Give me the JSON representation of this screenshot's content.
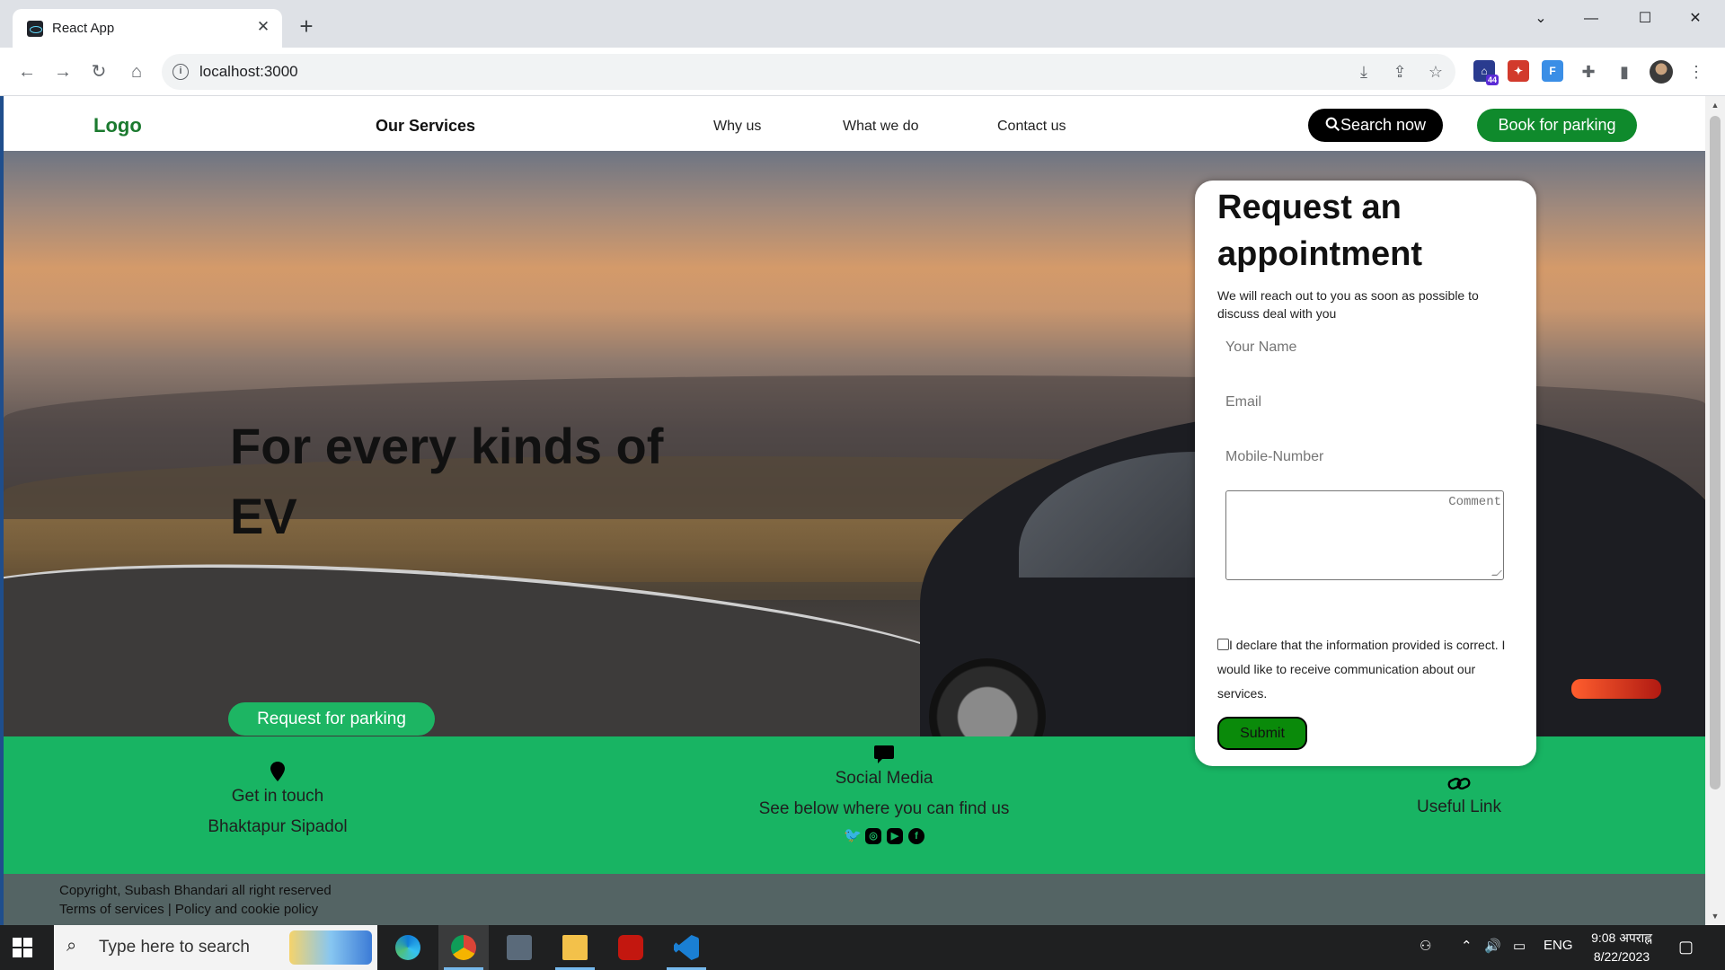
{
  "browser": {
    "tab_title": "React App",
    "tab_close": "✕",
    "new_tab": "+",
    "url": "localhost:3000",
    "extension_badge": "44"
  },
  "site": {
    "logo": "Logo",
    "services": "Our Services",
    "nav": [
      "Why us",
      "What we do",
      "Contact us"
    ],
    "search_button": "Search now",
    "book_button": "Book for parking"
  },
  "hero": {
    "heading": "For every kinds of EV",
    "request_button": "Request for parking"
  },
  "form": {
    "title": "Request an appointment",
    "subtitle": "We will reach out to you as soon as possible to discuss deal with you",
    "name_placeholder": "Your Name",
    "email_placeholder": "Email",
    "mobile_placeholder": "Mobile-Number",
    "comment_placeholder": "Comment",
    "declaration": "I declare that the information provided is correct. I would like to receive communication about our services.",
    "submit": "Submit"
  },
  "footer": {
    "contact_title": "Get in touch",
    "contact_address": "Bhaktapur Sipadol",
    "social_title": "Social Media",
    "social_sub": "See below where you can find us",
    "social_icons": [
      "twitter-icon",
      "instagram-icon",
      "youtube-icon",
      "facebook-icon"
    ],
    "links_title": "Useful Link",
    "copyright": "Copyright, Subash Bhandari all right reserved",
    "terms": "Terms of services | Policy and cookie policy"
  },
  "taskbar": {
    "search_placeholder": "Type here to search",
    "language": "ENG",
    "time": "9:08 अपराह्न",
    "date": "8/22/2023"
  },
  "colors": {
    "brand_green": "#0f8a2c",
    "band_green": "#18b463",
    "footer_grey": "#546464"
  }
}
